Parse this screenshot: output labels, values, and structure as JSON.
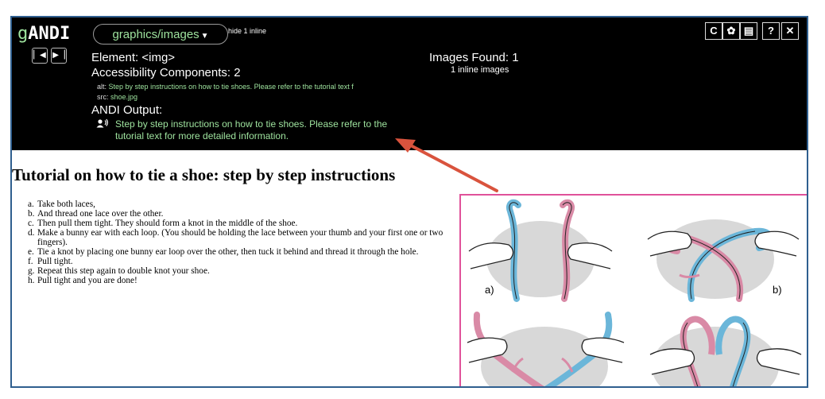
{
  "andi": {
    "logo_prefix": "g",
    "logo_main": "ANDI",
    "module_label": "graphics/images",
    "hide_inline": "hide 1 inline",
    "element_line": "Element: <img>",
    "components_line": "Accessibility Components: 2",
    "alt_key": "alt:",
    "alt_value": "Step by step instructions on how to tie shoes. Please refer to the tutorial text f",
    "src_key": "src:",
    "src_value": "shoe.jpg",
    "output_label": "ANDI Output:",
    "output_text": "Step by step instructions on how to tie shoes. Please refer to the tutorial text for more detailed information.",
    "images_found": "Images Found: 1",
    "inline_count": "1 inline images",
    "prev_icon": "prev-element-icon",
    "next_icon": "next-element-icon",
    "tools": [
      {
        "name": "refresh-icon",
        "glyph": "C"
      },
      {
        "name": "settings-icon",
        "glyph": "✿"
      },
      {
        "name": "keyboard-icon",
        "glyph": "▤"
      },
      {
        "name": "help-icon",
        "glyph": "?"
      },
      {
        "name": "close-icon",
        "glyph": "✕"
      }
    ]
  },
  "page": {
    "title": "Tutorial on how to tie a shoe: step by step instructions",
    "steps": [
      {
        "marker": "a.",
        "text": "Take both laces,"
      },
      {
        "marker": "b.",
        "text": "And thread one lace over the other."
      },
      {
        "marker": "c.",
        "text": "Then pull them tight. They should form a knot in the middle of the shoe."
      },
      {
        "marker": "d.",
        "text": "Make a bunny ear with each loop. (You should be holding the lace between your thumb and your first one or two fingers)."
      },
      {
        "marker": "e.",
        "text": "Tie a knot by placing one bunny ear loop over the other, then tuck it behind and thread it through the hole."
      },
      {
        "marker": "f.",
        "text": "Pull tight."
      },
      {
        "marker": "g.",
        "text": "Repeat this step again to double knot your shoe."
      },
      {
        "marker": "h.",
        "text": "Pull tight and you are done!"
      }
    ],
    "panel_labels": [
      "a)",
      "b)"
    ]
  },
  "colors": {
    "andi_bg": "#000000",
    "andi_green": "#9fe49f",
    "image_border": "#e0529a",
    "frame_border": "#2f5f8f",
    "arrow": "#d9533d",
    "lace_blue": "#6bb6d9",
    "lace_pink": "#d98aa6"
  }
}
